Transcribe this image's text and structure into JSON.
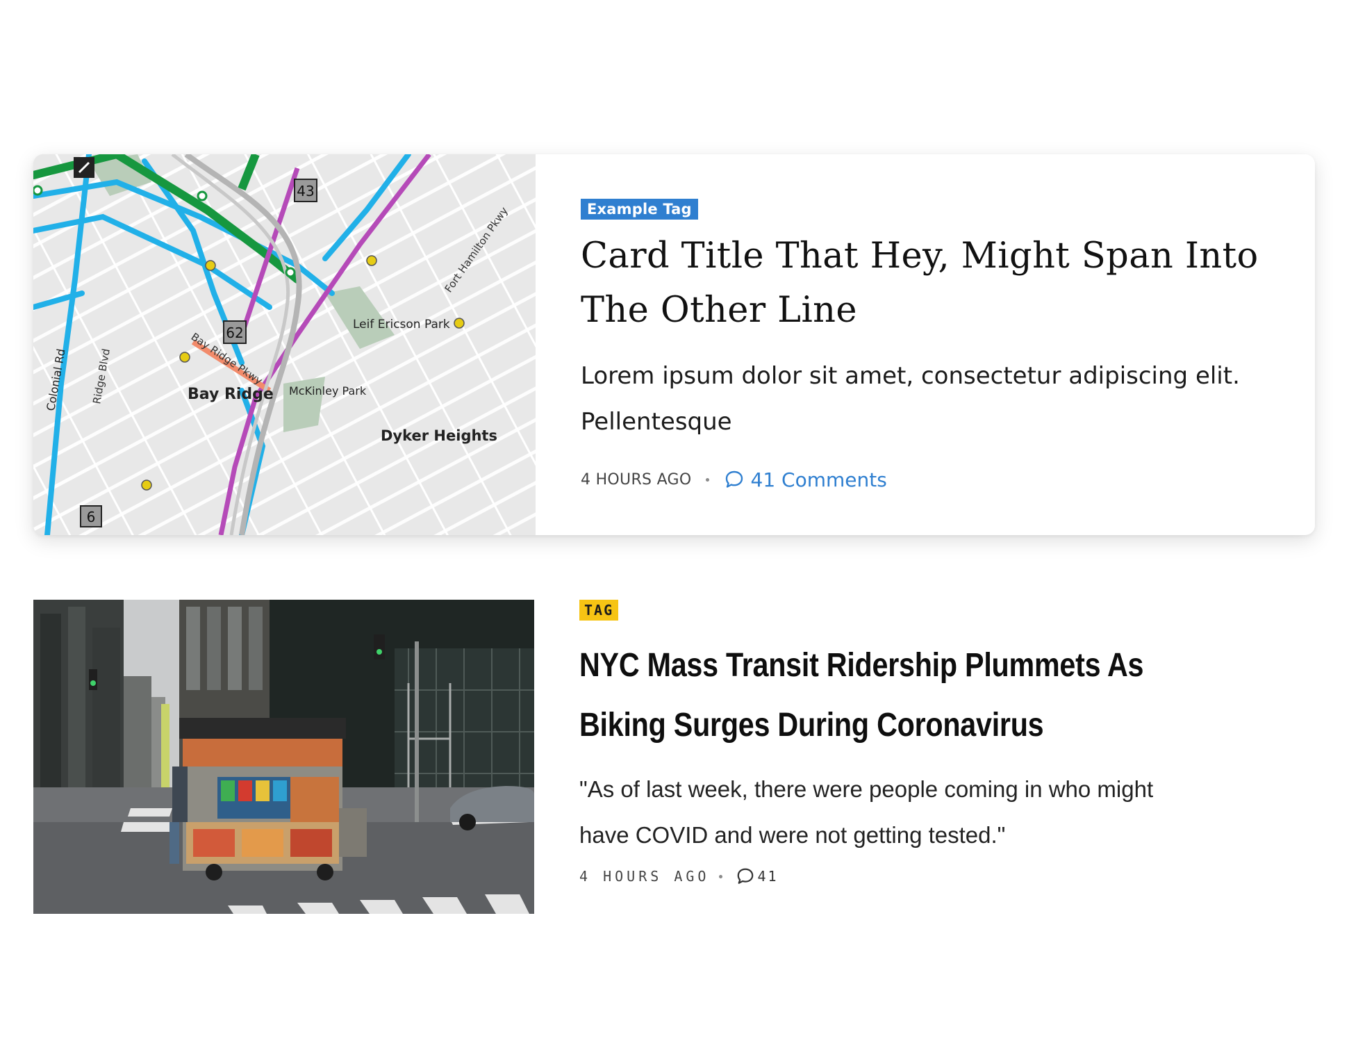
{
  "cards": [
    {
      "tag": "Example Tag",
      "title": "Card Title That Hey, Might Span Into The Other Line",
      "excerpt": "Lorem ipsum dolor sit amet, consectetur adipiscing elit. Pellentesque",
      "time": "4 HOURS AGO",
      "comments": "41 Comments",
      "accent_color": "#2f7fd0",
      "image": "subway-map",
      "map_labels": {
        "bay_ridge": "Bay Ridge",
        "dyker_heights": "Dyker Heights",
        "leif_ericson_park": "Leif Ericson Park",
        "mckinley_park": "McKinley Park",
        "colonial_rd": "Colonial Rd",
        "ridge_blvd": "Ridge Blvd",
        "fort_hamilton": "Fort Hamilton Pkwy",
        "bay_ridge_pkwy": "Bay Ridge Pkwy",
        "route_43": "43",
        "route_62": "62",
        "route_6": "6"
      }
    },
    {
      "tag": "TAG",
      "title": "NYC Mass Transit Ridership Plummets As Biking Surges During Coronavirus",
      "excerpt": "\"As of last week, there were people coming in who might have COVID and were not getting tested.\"",
      "time": "4 HOURS AGO",
      "comments": "41",
      "accent_color": "#f6c414",
      "image": "street-food-cart-photo"
    }
  ]
}
